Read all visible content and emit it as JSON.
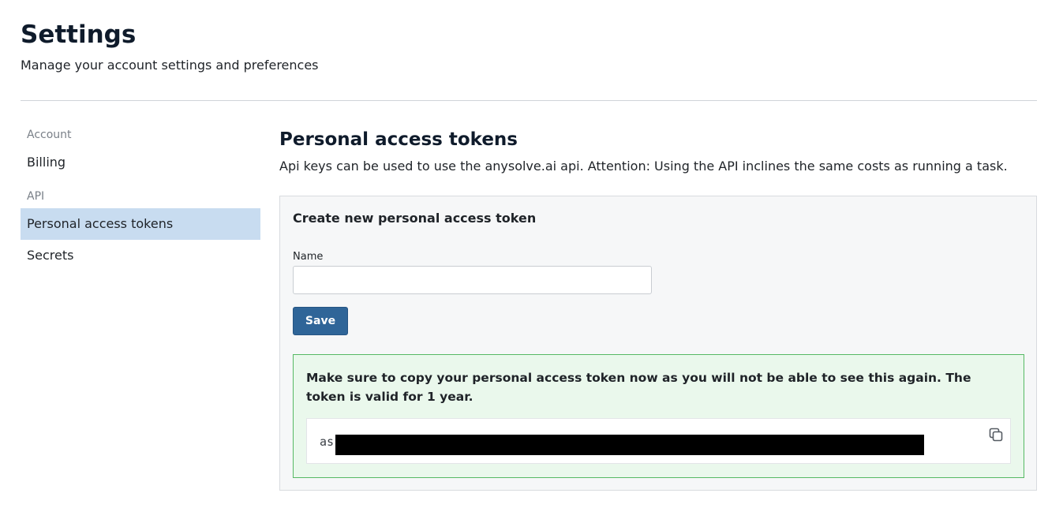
{
  "header": {
    "title": "Settings",
    "subtitle": "Manage your account settings and preferences"
  },
  "sidebar": {
    "sections": [
      {
        "label": "Account",
        "items": [
          {
            "label": "Billing",
            "active": false
          }
        ]
      },
      {
        "label": "API",
        "items": [
          {
            "label": "Personal access tokens",
            "active": true
          },
          {
            "label": "Secrets",
            "active": false
          }
        ]
      }
    ]
  },
  "main": {
    "title": "Personal access tokens",
    "description": "Api keys can be used to use the anysolve.ai api. Attention: Using the API inclines the same costs as running a task.",
    "create_card": {
      "title": "Create new personal access token",
      "name_label": "Name",
      "name_value": "",
      "save_label": "Save"
    },
    "alert": {
      "message": "Make sure to copy your personal access token now as you will not be able to see this again. The token is valid for 1 year.",
      "token_prefix": "as:",
      "token_redacted": true,
      "copy_icon": "copy-icon"
    }
  },
  "colors": {
    "active_nav_bg": "#c8dcf0",
    "primary_button": "#2f6598",
    "alert_bg": "#eaf8ec",
    "alert_border": "#56b964"
  }
}
